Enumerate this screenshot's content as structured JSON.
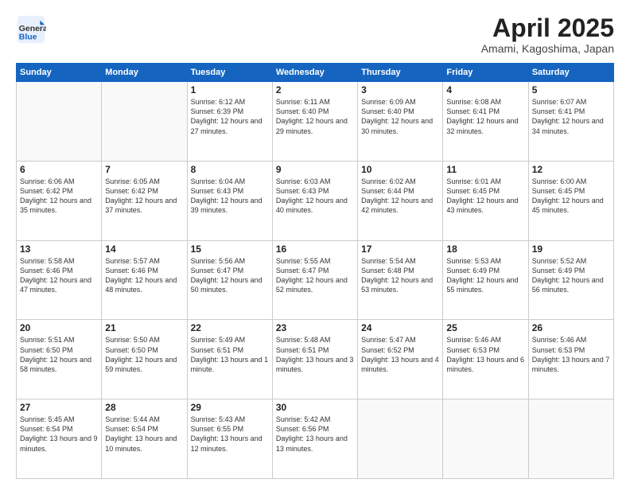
{
  "header": {
    "logo_general": "General",
    "logo_blue": "Blue",
    "title": "April 2025",
    "location": "Amami, Kagoshima, Japan"
  },
  "weekdays": [
    "Sunday",
    "Monday",
    "Tuesday",
    "Wednesday",
    "Thursday",
    "Friday",
    "Saturday"
  ],
  "weeks": [
    [
      {
        "day": "",
        "info": ""
      },
      {
        "day": "",
        "info": ""
      },
      {
        "day": "1",
        "info": "Sunrise: 6:12 AM\nSunset: 6:39 PM\nDaylight: 12 hours and 27 minutes."
      },
      {
        "day": "2",
        "info": "Sunrise: 6:11 AM\nSunset: 6:40 PM\nDaylight: 12 hours and 29 minutes."
      },
      {
        "day": "3",
        "info": "Sunrise: 6:09 AM\nSunset: 6:40 PM\nDaylight: 12 hours and 30 minutes."
      },
      {
        "day": "4",
        "info": "Sunrise: 6:08 AM\nSunset: 6:41 PM\nDaylight: 12 hours and 32 minutes."
      },
      {
        "day": "5",
        "info": "Sunrise: 6:07 AM\nSunset: 6:41 PM\nDaylight: 12 hours and 34 minutes."
      }
    ],
    [
      {
        "day": "6",
        "info": "Sunrise: 6:06 AM\nSunset: 6:42 PM\nDaylight: 12 hours and 35 minutes."
      },
      {
        "day": "7",
        "info": "Sunrise: 6:05 AM\nSunset: 6:42 PM\nDaylight: 12 hours and 37 minutes."
      },
      {
        "day": "8",
        "info": "Sunrise: 6:04 AM\nSunset: 6:43 PM\nDaylight: 12 hours and 39 minutes."
      },
      {
        "day": "9",
        "info": "Sunrise: 6:03 AM\nSunset: 6:43 PM\nDaylight: 12 hours and 40 minutes."
      },
      {
        "day": "10",
        "info": "Sunrise: 6:02 AM\nSunset: 6:44 PM\nDaylight: 12 hours and 42 minutes."
      },
      {
        "day": "11",
        "info": "Sunrise: 6:01 AM\nSunset: 6:45 PM\nDaylight: 12 hours and 43 minutes."
      },
      {
        "day": "12",
        "info": "Sunrise: 6:00 AM\nSunset: 6:45 PM\nDaylight: 12 hours and 45 minutes."
      }
    ],
    [
      {
        "day": "13",
        "info": "Sunrise: 5:58 AM\nSunset: 6:46 PM\nDaylight: 12 hours and 47 minutes."
      },
      {
        "day": "14",
        "info": "Sunrise: 5:57 AM\nSunset: 6:46 PM\nDaylight: 12 hours and 48 minutes."
      },
      {
        "day": "15",
        "info": "Sunrise: 5:56 AM\nSunset: 6:47 PM\nDaylight: 12 hours and 50 minutes."
      },
      {
        "day": "16",
        "info": "Sunrise: 5:55 AM\nSunset: 6:47 PM\nDaylight: 12 hours and 52 minutes."
      },
      {
        "day": "17",
        "info": "Sunrise: 5:54 AM\nSunset: 6:48 PM\nDaylight: 12 hours and 53 minutes."
      },
      {
        "day": "18",
        "info": "Sunrise: 5:53 AM\nSunset: 6:49 PM\nDaylight: 12 hours and 55 minutes."
      },
      {
        "day": "19",
        "info": "Sunrise: 5:52 AM\nSunset: 6:49 PM\nDaylight: 12 hours and 56 minutes."
      }
    ],
    [
      {
        "day": "20",
        "info": "Sunrise: 5:51 AM\nSunset: 6:50 PM\nDaylight: 12 hours and 58 minutes."
      },
      {
        "day": "21",
        "info": "Sunrise: 5:50 AM\nSunset: 6:50 PM\nDaylight: 12 hours and 59 minutes."
      },
      {
        "day": "22",
        "info": "Sunrise: 5:49 AM\nSunset: 6:51 PM\nDaylight: 13 hours and 1 minute."
      },
      {
        "day": "23",
        "info": "Sunrise: 5:48 AM\nSunset: 6:51 PM\nDaylight: 13 hours and 3 minutes."
      },
      {
        "day": "24",
        "info": "Sunrise: 5:47 AM\nSunset: 6:52 PM\nDaylight: 13 hours and 4 minutes."
      },
      {
        "day": "25",
        "info": "Sunrise: 5:46 AM\nSunset: 6:53 PM\nDaylight: 13 hours and 6 minutes."
      },
      {
        "day": "26",
        "info": "Sunrise: 5:46 AM\nSunset: 6:53 PM\nDaylight: 13 hours and 7 minutes."
      }
    ],
    [
      {
        "day": "27",
        "info": "Sunrise: 5:45 AM\nSunset: 6:54 PM\nDaylight: 13 hours and 9 minutes."
      },
      {
        "day": "28",
        "info": "Sunrise: 5:44 AM\nSunset: 6:54 PM\nDaylight: 13 hours and 10 minutes."
      },
      {
        "day": "29",
        "info": "Sunrise: 5:43 AM\nSunset: 6:55 PM\nDaylight: 13 hours and 12 minutes."
      },
      {
        "day": "30",
        "info": "Sunrise: 5:42 AM\nSunset: 6:56 PM\nDaylight: 13 hours and 13 minutes."
      },
      {
        "day": "",
        "info": ""
      },
      {
        "day": "",
        "info": ""
      },
      {
        "day": "",
        "info": ""
      }
    ]
  ]
}
